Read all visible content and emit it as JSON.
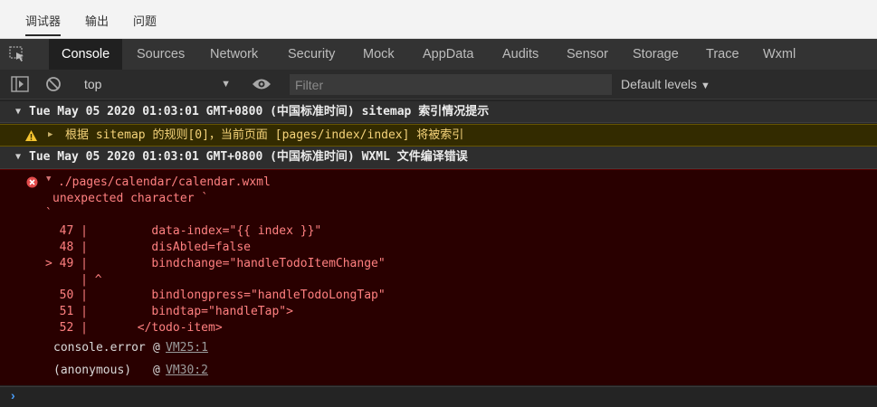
{
  "top_tabs": [
    "调试器",
    "输出",
    "问题"
  ],
  "nav": {
    "tabs": [
      "Console",
      "Sources",
      "Network",
      "Security",
      "Mock",
      "AppData",
      "Audits",
      "Sensor",
      "Storage",
      "Trace",
      "Wxml"
    ],
    "active": "Console"
  },
  "toolbar": {
    "context": "top",
    "filter_placeholder": "Filter",
    "levels": "Default levels"
  },
  "messages": {
    "group1_header": "Tue May 05 2020 01:03:01 GMT+0800 (中国标准时间) sitemap 索引情况提示",
    "warning_text": "根据 sitemap 的规则[0]，当前页面 [pages/index/index] 将被索引",
    "group2_header": "Tue May 05 2020 01:03:01 GMT+0800 (中国标准时间)  WXML 文件编译错误",
    "error": {
      "file": "./pages/calendar/calendar.wxml",
      "line1": "unexpected character `",
      "line2": "`",
      "code": [
        "  47 |         data-index=\"{{ index }}\"",
        "  48 |         disAbled=false",
        "> 49 |         bindchange=\"handleTodoItemChange\"",
        "     | ^",
        "  50 |         bindlongpress=\"handleTodoLongTap\"",
        "  51 |         bindtap=\"handleTap\">",
        "  52 |       </todo-item>"
      ],
      "stack": [
        {
          "fn": "console.error",
          "at": "@",
          "loc": "VM25:1"
        },
        {
          "fn": "(anonymous)",
          "at": "@",
          "loc": "VM30:2"
        }
      ]
    }
  },
  "prompt_symbol": "›",
  "colors": {
    "active_tab_bg": "#202020",
    "error_bg": "#290000",
    "warning_bg": "#332b00",
    "prompt": "#4a9df8"
  }
}
